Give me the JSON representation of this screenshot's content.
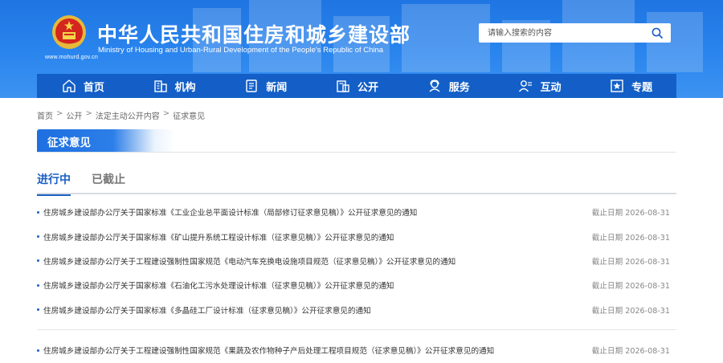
{
  "header": {
    "site_url": "www.mohurd.gov.cn",
    "title": "中华人民共和国住房和城乡建设部",
    "subtitle": "Ministry of Housing and Urban-Rural Development of the People's Republic of China",
    "search_placeholder": "请输入搜索的内容",
    "brand_color": "#1f75e2",
    "nav_color": "#135fc7"
  },
  "nav": {
    "items": [
      {
        "label": "首页",
        "icon": "home-icon"
      },
      {
        "label": "机构",
        "icon": "building-icon"
      },
      {
        "label": "新闻",
        "icon": "news-icon"
      },
      {
        "label": "公开",
        "icon": "document-icon"
      },
      {
        "label": "服务",
        "icon": "service-icon"
      },
      {
        "label": "互动",
        "icon": "interaction-icon"
      },
      {
        "label": "专题",
        "icon": "star-icon"
      }
    ]
  },
  "breadcrumb": {
    "items": [
      "首页",
      "公开",
      "法定主动公开内容",
      "征求意见"
    ],
    "separator": ">"
  },
  "section": {
    "title": "征求意见"
  },
  "tabs": [
    {
      "label": "进行中",
      "active": true
    },
    {
      "label": "已截止",
      "active": false
    }
  ],
  "list": {
    "deadline_prefix": "截止日期",
    "items": [
      {
        "title": "住房城乡建设部办公厅关于国家标准《工业企业总平面设计标准（局部修订征求意见稿）》公开征求意见的通知",
        "deadline": "2026-08-31"
      },
      {
        "title": "住房城乡建设部办公厅关于国家标准《矿山提升系统工程设计标准（征求意见稿）》公开征求意见的通知",
        "deadline": "2026-08-31"
      },
      {
        "title": "住房城乡建设部办公厅关于工程建设强制性国家规范《电动汽车充换电设施项目规范（征求意见稿）》公开征求意见的通知",
        "deadline": "2026-08-31"
      },
      {
        "title": "住房城乡建设部办公厅关于国家标准《石油化工污水处理设计标准（征求意见稿）》公开征求意见的通知",
        "deadline": "2026-08-31"
      },
      {
        "title": "住房城乡建设部办公厅关于国家标准《多晶硅工厂设计标准（征求意见稿）》公开征求意见的通知",
        "deadline": "2026-08-31"
      },
      {
        "title": "住房城乡建设部办公厅关于工程建设强制性国家规范《果蔬及农作物种子产后处理工程项目规范（征求意见稿）》公开征求意见的通知",
        "deadline": "2026-08-31"
      }
    ]
  }
}
